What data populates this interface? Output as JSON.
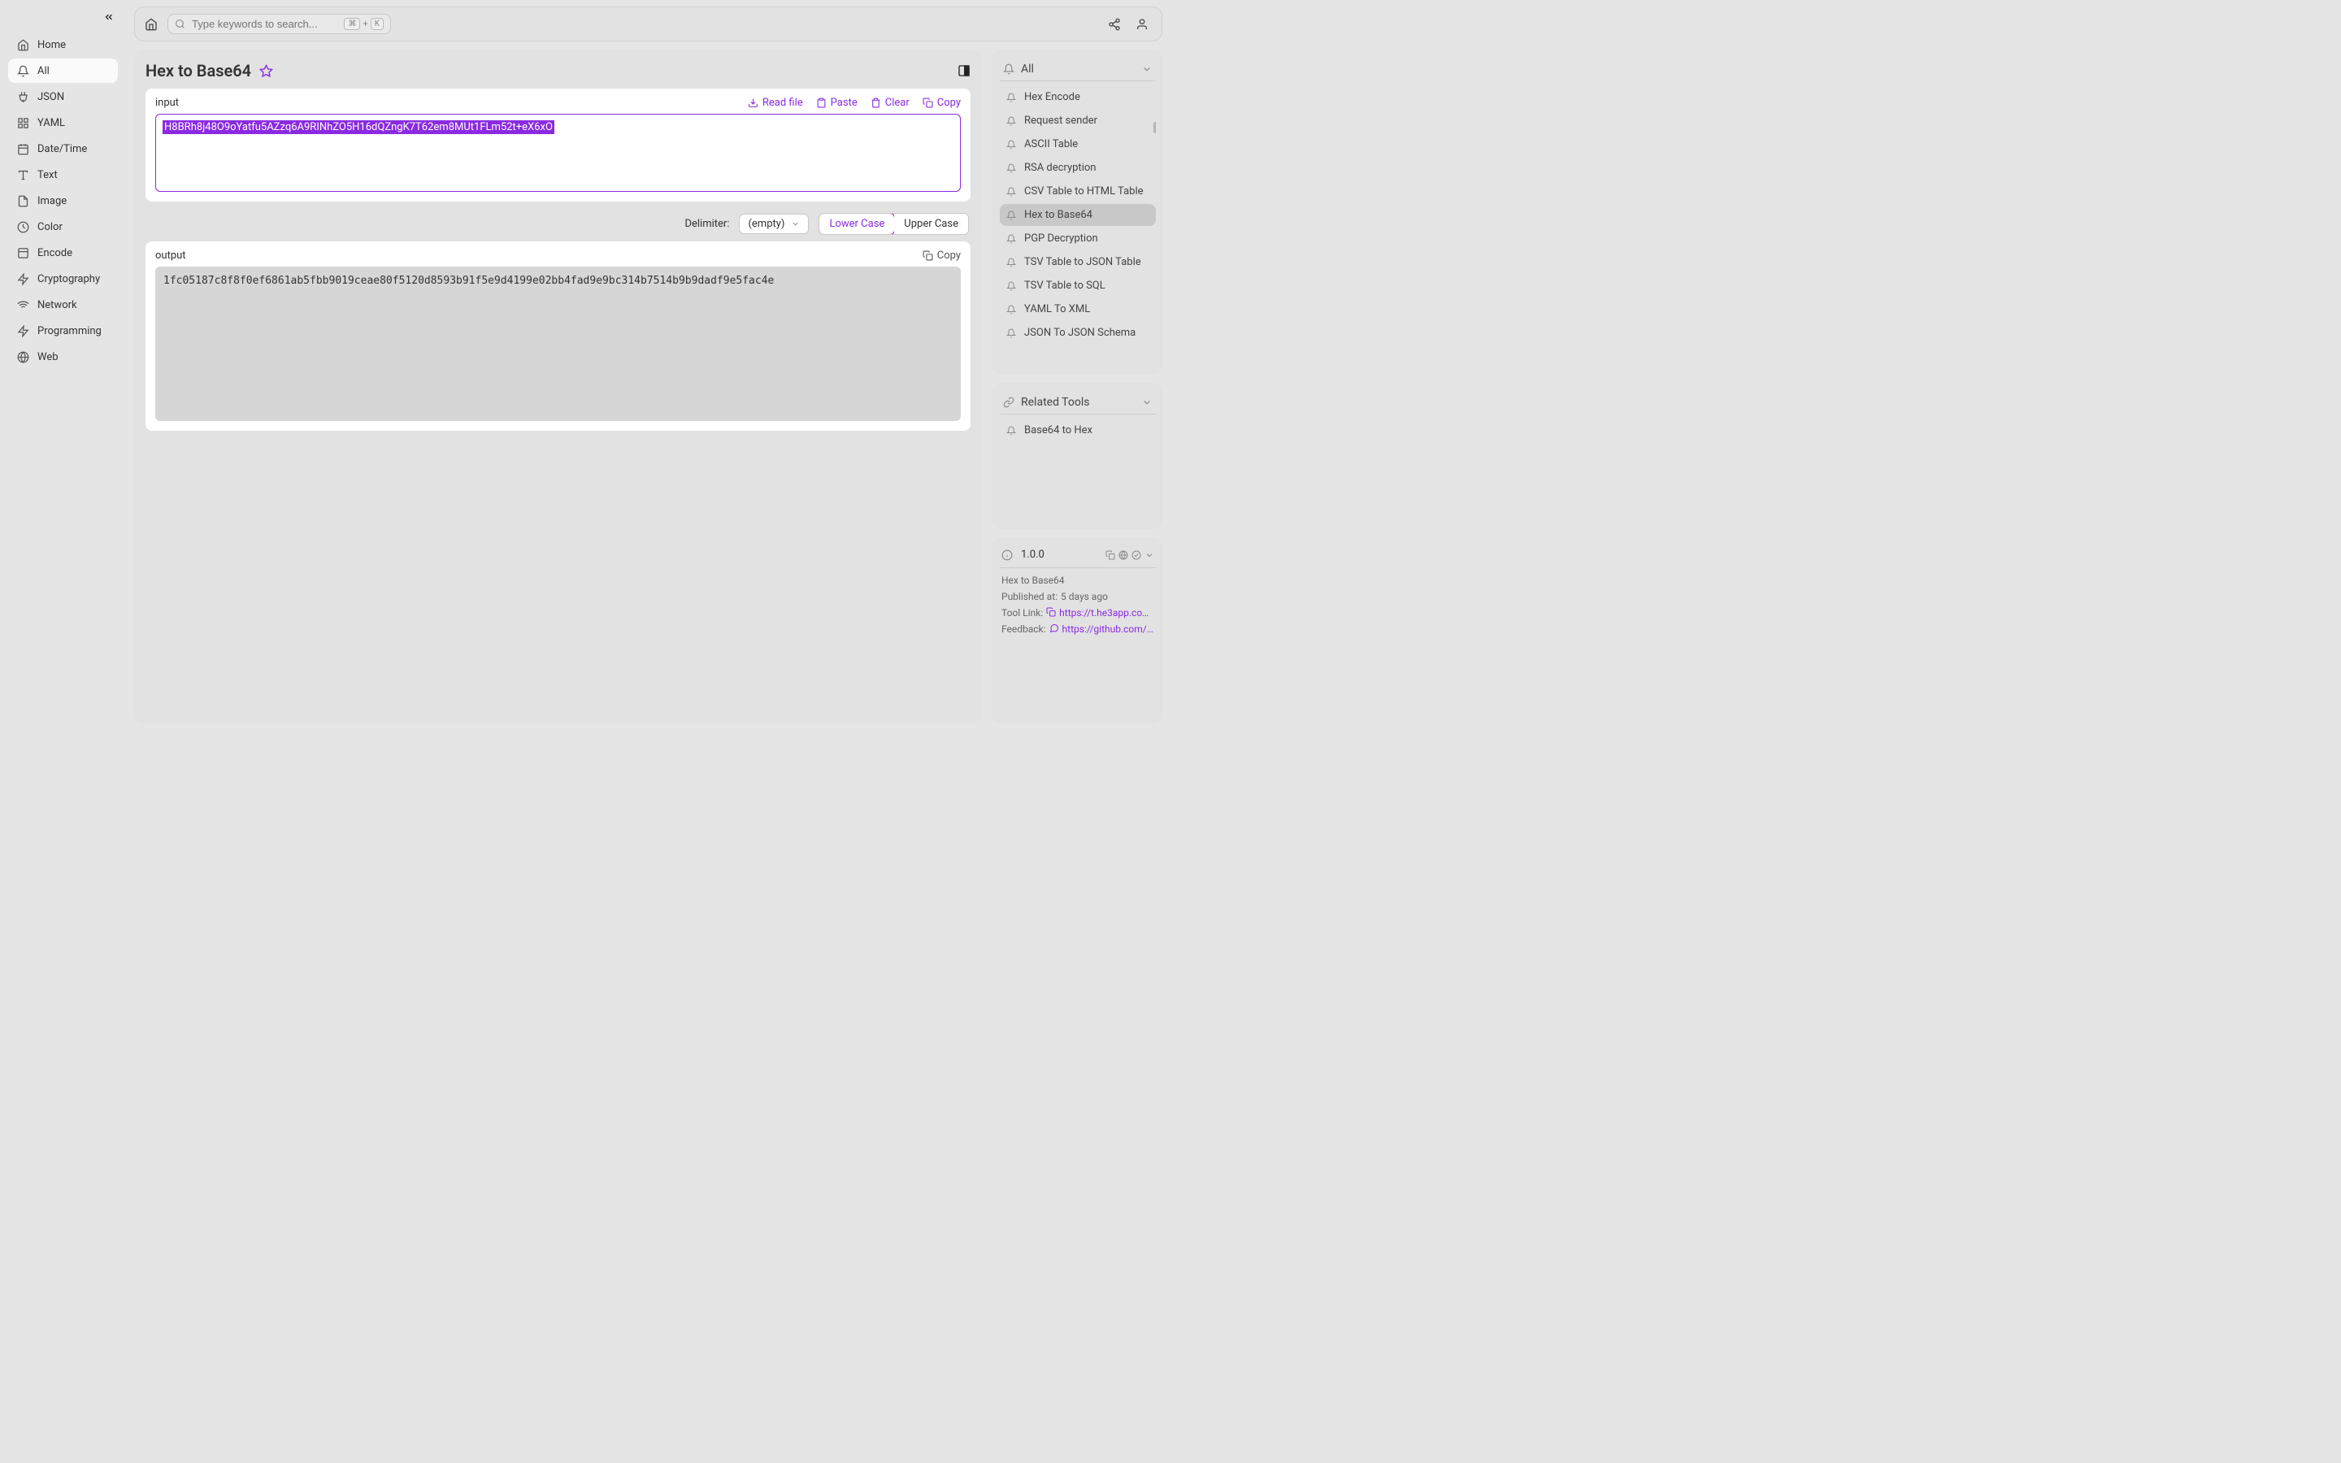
{
  "sidebar": {
    "items": [
      {
        "label": "Home",
        "icon": "home"
      },
      {
        "label": "All",
        "icon": "bell",
        "active": true
      },
      {
        "label": "JSON",
        "icon": "plug"
      },
      {
        "label": "YAML",
        "icon": "grid"
      },
      {
        "label": "Date/Time",
        "icon": "calendar"
      },
      {
        "label": "Text",
        "icon": "type"
      },
      {
        "label": "Image",
        "icon": "file"
      },
      {
        "label": "Color",
        "icon": "loader"
      },
      {
        "label": "Encode",
        "icon": "box"
      },
      {
        "label": "Cryptography",
        "icon": "zap"
      },
      {
        "label": "Network",
        "icon": "wifi"
      },
      {
        "label": "Programming",
        "icon": "zap"
      },
      {
        "label": "Web",
        "icon": "globe"
      }
    ]
  },
  "search": {
    "placeholder": "Type keywords to search...",
    "key1": "⌘",
    "plus": "+",
    "key2": "K"
  },
  "page": {
    "title": "Hex to Base64",
    "input_label": "input",
    "output_label": "output",
    "actions": {
      "read_file": "Read file",
      "paste": "Paste",
      "clear": "Clear",
      "copy": "Copy"
    },
    "input_value": "H8BRh8j48O9oYatfu5AZzq6A9RINhZO5H16dQZngK7T62em8MUt1FLm52t+eX6xO",
    "delimiter_label": "Delimiter:",
    "delimiter_value": "(empty)",
    "case_lower": "Lower Case",
    "case_upper": "Upper Case",
    "output_value": "1fc05187c8f8f0ef6861ab5fbb9019ceae80f5120d8593b91f5e9d4199e02bb4fad9e9bc314b7514b9b9dadf9e5fac4e"
  },
  "right": {
    "all_label": "All",
    "tools": [
      "Hex Encode",
      "Request sender",
      "ASCII Table",
      "RSA decryption",
      "CSV Table to HTML Table",
      "Hex to Base64",
      "PGP Decryption",
      "TSV Table to JSON Table",
      "TSV Table to SQL",
      "YAML To XML",
      "JSON To JSON Schema"
    ],
    "active_tool_index": 5,
    "related_label": "Related Tools",
    "related": [
      "Base64 to Hex"
    ],
    "version": "1.0.0",
    "info_title": "Hex to Base64",
    "published_label": "Published at:",
    "published_value": "5 days ago",
    "tool_link_label": "Tool Link:",
    "tool_link_value": "https://t.he3app.co…",
    "feedback_label": "Feedback:",
    "feedback_value": "https://github.com/…"
  }
}
